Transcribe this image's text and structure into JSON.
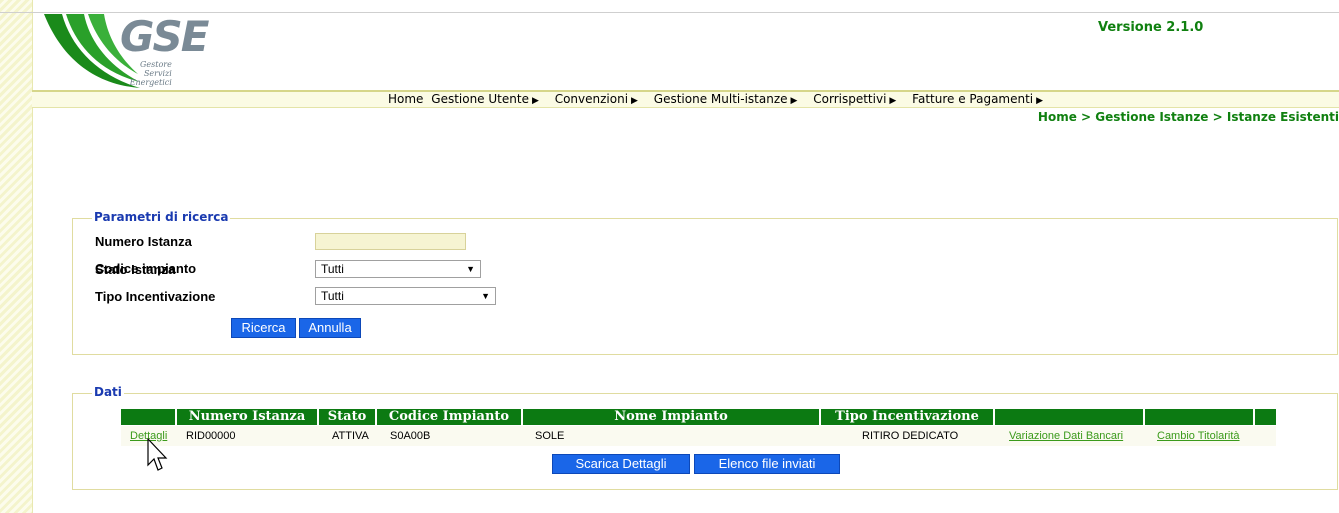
{
  "brand": {
    "logo_text": "GSE",
    "logo_sub": [
      "Gestore",
      "Servizi",
      "Energetici"
    ],
    "version": "Versione 2.1.0"
  },
  "menu": [
    {
      "label": "Home",
      "has_arrow": false
    },
    {
      "label": "Gestione Utente",
      "has_arrow": true
    },
    {
      "label": "Convenzioni",
      "has_arrow": true
    },
    {
      "label": "Gestione Multi-istanze",
      "has_arrow": true
    },
    {
      "label": "Corrispettivi",
      "has_arrow": true
    },
    {
      "label": "Fatture e Pagamenti",
      "has_arrow": true
    }
  ],
  "breadcrumb": "Home > Gestione Istanze > Istanze Esistenti",
  "search": {
    "legend": "Parametri di ricerca",
    "numero_istanza_label": "Numero Istanza",
    "numero_istanza_value": "",
    "codice_impianto_label": "Codice impianto",
    "codice_impianto_value": "",
    "stato_istanza_label": "Stato Istanza",
    "stato_istanza_value": "Tutti",
    "tipo_incentivazione_label": "Tipo Incentivazione",
    "tipo_incentivazione_value": "Tutti",
    "ricerca_button": "Ricerca",
    "annulla_button": "Annulla"
  },
  "results": {
    "legend": "Dati",
    "columns": [
      "",
      "Numero Istanza",
      "Stato",
      "Codice Impianto",
      "Nome Impianto",
      "Tipo Incentivazione",
      "",
      ""
    ],
    "rows": [
      {
        "dettagli": "Dettagli",
        "numero_istanza": "RID00000",
        "stato": "ATTIVA",
        "codice_impianto": "S0A00B",
        "nome_impianto": "SOLE",
        "tipo_incentivazione": "RITIRO DEDICATO",
        "variazione": "Variazione Dati Bancari",
        "cambio": "Cambio Titolarità"
      }
    ],
    "scarica_button": "Scarica Dettagli",
    "elenco_button": "Elenco file inviati"
  },
  "colors": {
    "header_green": "#0c7a12",
    "button_blue": "#1a66e8",
    "link_green": "#3a9a1a",
    "legend_blue": "#1a3ab0"
  }
}
